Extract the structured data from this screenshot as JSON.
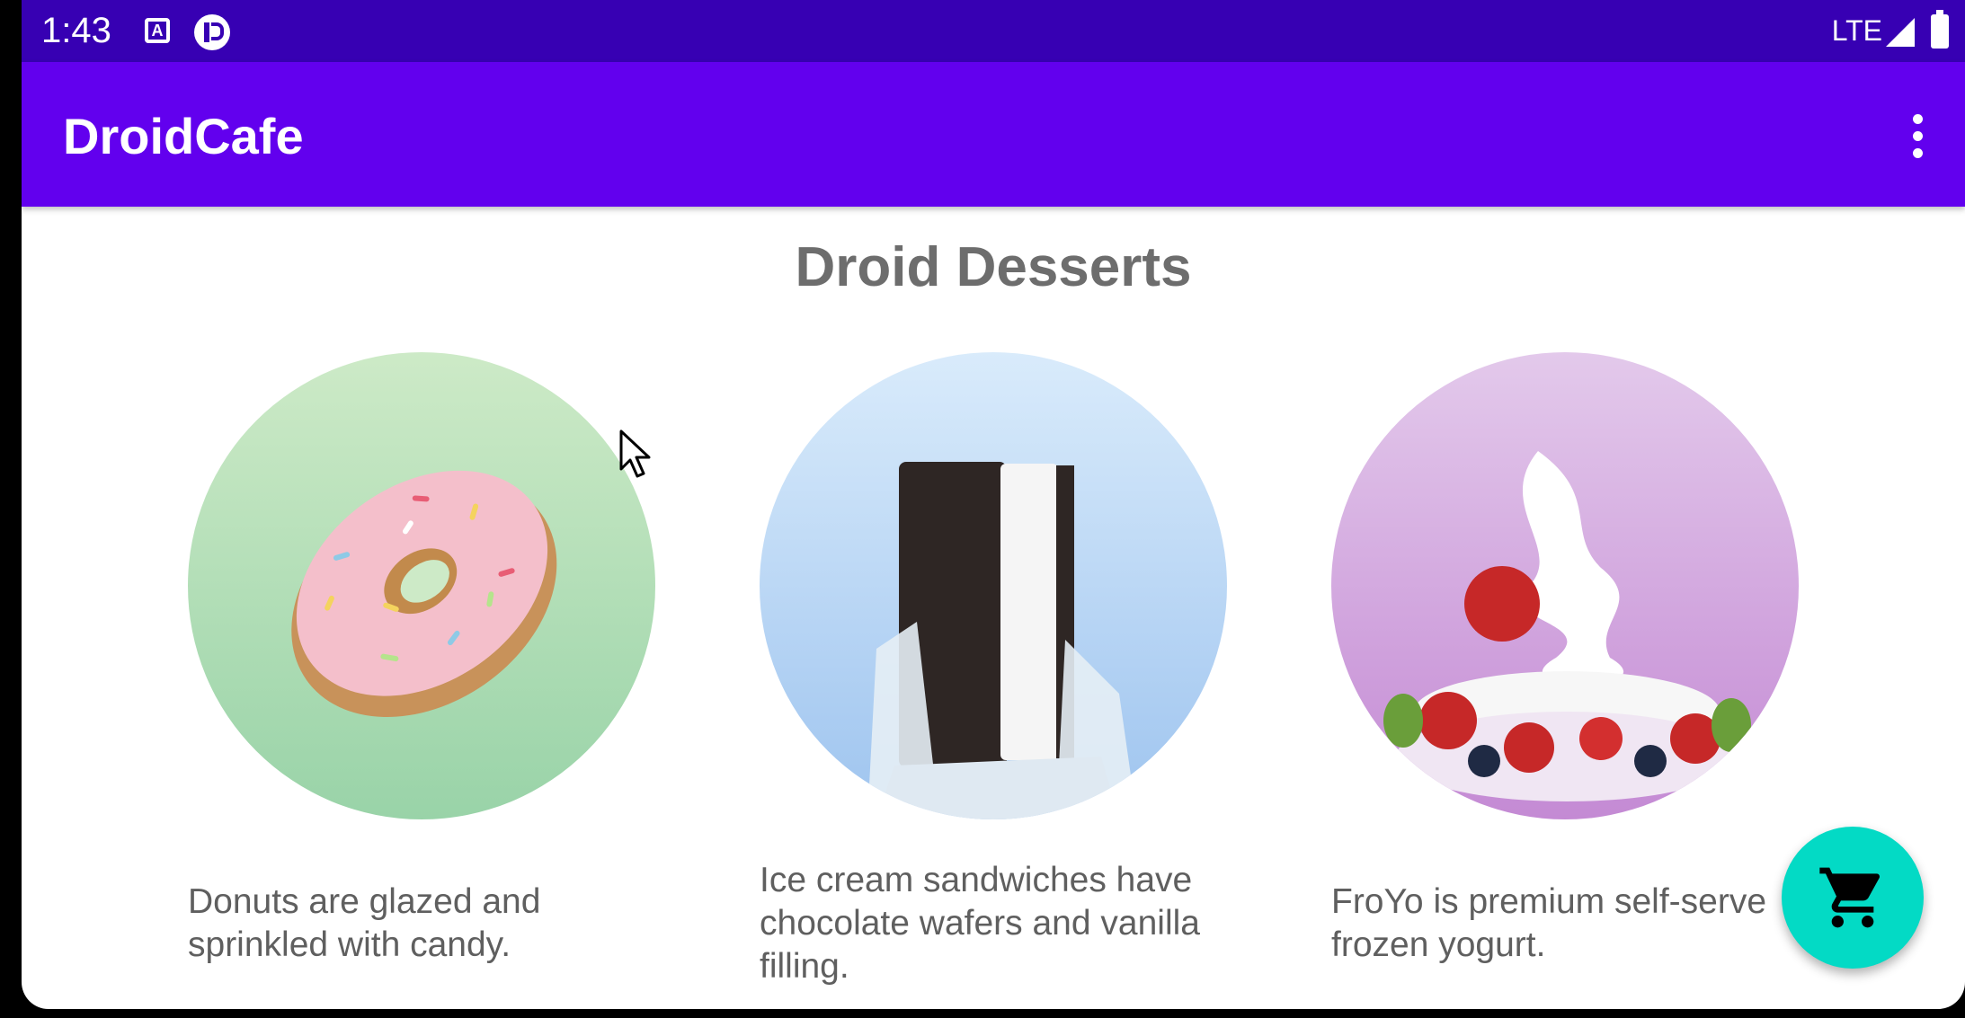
{
  "status_bar": {
    "time": "1:43",
    "network": "LTE",
    "icons": [
      "keyboard-a-icon",
      "app-circle-icon",
      "signal-icon",
      "battery-icon"
    ]
  },
  "app_bar": {
    "title": "DroidCafe",
    "menu_icon": "more-vert-icon",
    "color": "#6200ee"
  },
  "main": {
    "heading": "Droid Desserts",
    "items": [
      {
        "image": "donut",
        "description": "Donuts are glazed and sprinkled with candy."
      },
      {
        "image": "ice cream sandwich",
        "description": "Ice cream sandwiches have chocolate wafers and vanilla filling."
      },
      {
        "image": "froyo",
        "description": "FroYo is premium self-serve frozen yogurt."
      }
    ]
  },
  "fab": {
    "icon": "shopping-cart-icon",
    "color": "#03dac5"
  }
}
